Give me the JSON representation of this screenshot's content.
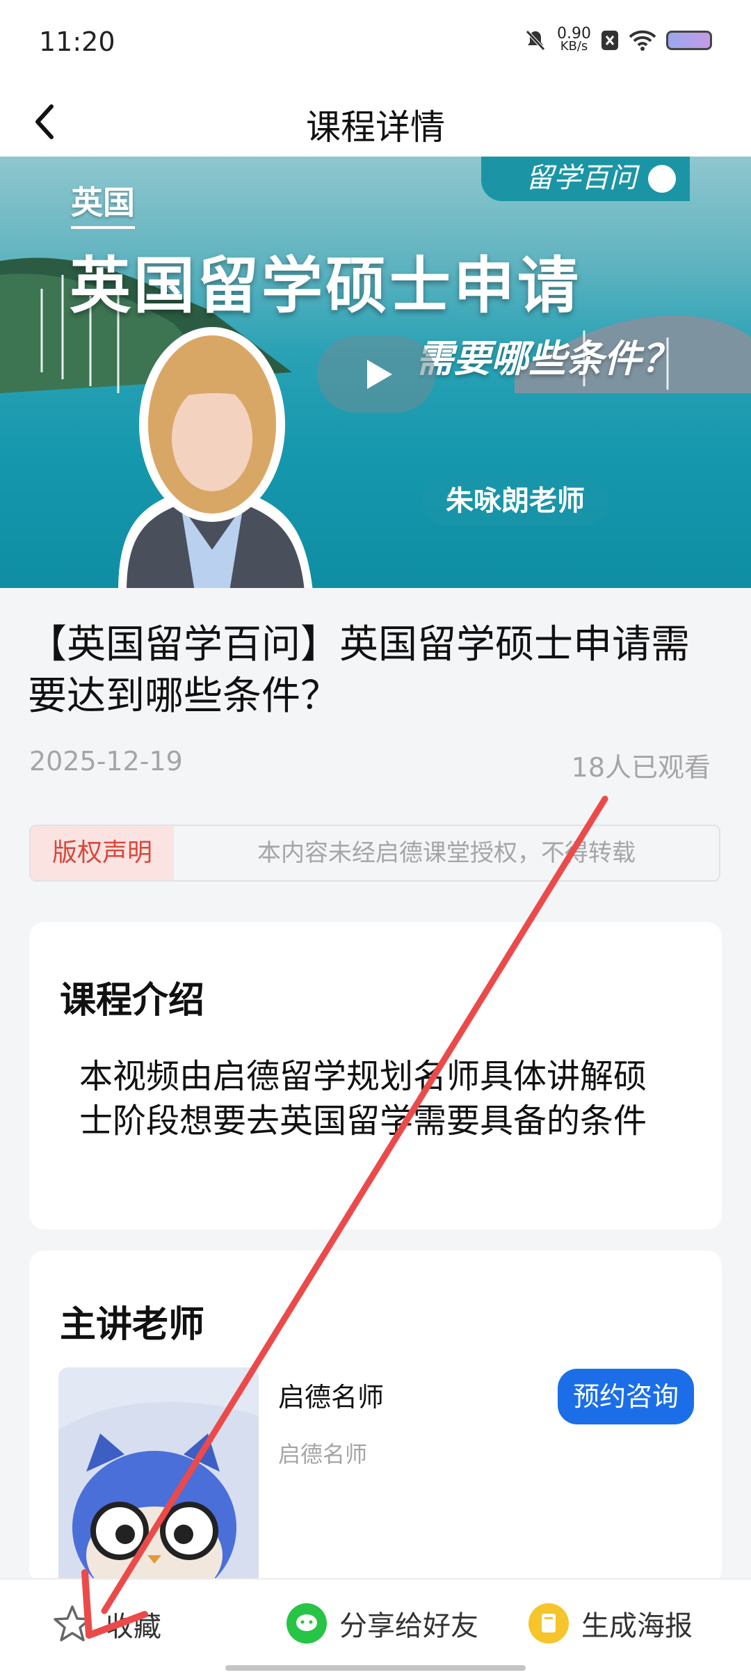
{
  "status_bar": {
    "time": "11:20",
    "speed_value": "0.90",
    "speed_unit": "KB/s"
  },
  "nav": {
    "title": "课程详情"
  },
  "video": {
    "brand_tag": "留学百问",
    "small_title": "英国",
    "headline": "英国留学硕士申请",
    "subline": "需要哪些条件？",
    "teacher_label": "朱咏朗老师"
  },
  "course": {
    "title": "【英国留学百问】英国留学硕士申请需要达到哪些条件？",
    "date": "2025-12-19",
    "views": "18人已观看"
  },
  "copyright": {
    "tag": "版权声明",
    "text": "本内容未经启德课堂授权，不得转载"
  },
  "intro": {
    "heading": "课程介绍",
    "text": "本视频由启德留学规划名师具体讲解硕士阶段想要去英国留学需要具备的条件"
  },
  "teacher": {
    "heading": "主讲老师",
    "name": "启德名师",
    "subtitle": "启德名师",
    "consult_label": "预约咨询"
  },
  "bottom_bar": {
    "favorite_label": "收藏",
    "share_label": "分享给好友",
    "poster_label": "生成海报"
  },
  "colors": {
    "accent_blue": "#1b6ee8",
    "copyright_red": "#d9473c",
    "annotation_arrow": "#ec4a4a"
  }
}
